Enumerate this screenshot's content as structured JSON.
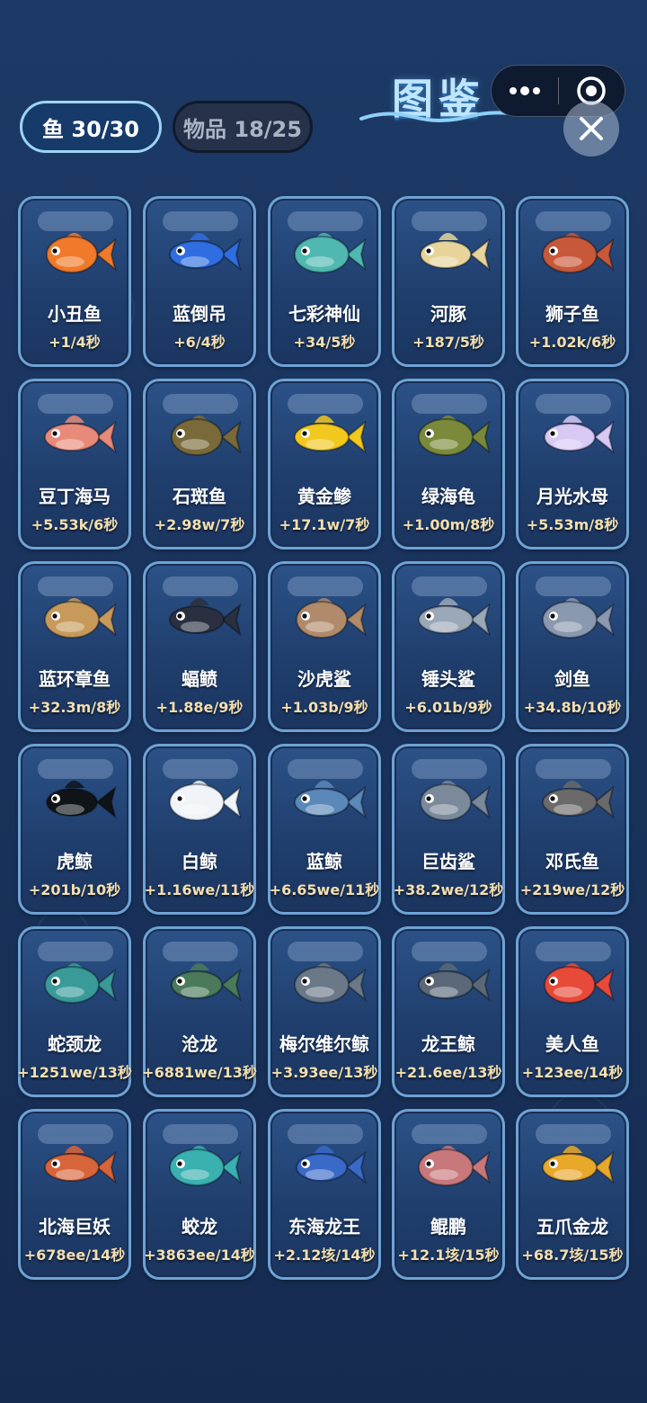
{
  "header": {
    "tabs": [
      {
        "label": "鱼 30/30",
        "active": true
      },
      {
        "label": "物品 18/25",
        "active": false
      }
    ],
    "title": "图鉴",
    "capsule": {
      "menu_icon": "more-dots-icon",
      "target_icon": "target-icon"
    },
    "close_icon": "close-icon"
  },
  "colors": {
    "background": "#1a3560",
    "card_border": "#6ea3d6",
    "rate_text": "#f3dfb0",
    "title": "#bfe6ff"
  },
  "fish": [
    {
      "name": "小丑鱼",
      "rate": "+1/4秒",
      "icon": "clownfish-icon",
      "color": "#f07a2a"
    },
    {
      "name": "蓝倒吊",
      "rate": "+6/4秒",
      "icon": "blue-tang-icon",
      "color": "#2e6ee0"
    },
    {
      "name": "七彩神仙",
      "rate": "+34/5秒",
      "icon": "discus-icon",
      "color": "#4fb8b0"
    },
    {
      "name": "河豚",
      "rate": "+187/5秒",
      "icon": "pufferfish-icon",
      "color": "#e6d49a"
    },
    {
      "name": "狮子鱼",
      "rate": "+1.02k/6秒",
      "icon": "lionfish-icon",
      "color": "#c8583a"
    },
    {
      "name": "豆丁海马",
      "rate": "+5.53k/6秒",
      "icon": "seahorse-icon",
      "color": "#e88a7a"
    },
    {
      "name": "石斑鱼",
      "rate": "+2.98w/7秒",
      "icon": "grouper-icon",
      "color": "#7a6a3a"
    },
    {
      "name": "黄金鲹",
      "rate": "+17.1w/7秒",
      "icon": "golden-trevally-icon",
      "color": "#f2c81e"
    },
    {
      "name": "绿海龟",
      "rate": "+1.00m/8秒",
      "icon": "sea-turtle-icon",
      "color": "#7a8a3a"
    },
    {
      "name": "月光水母",
      "rate": "+5.53m/8秒",
      "icon": "jellyfish-icon",
      "color": "#d8c8f4"
    },
    {
      "name": "蓝环章鱼",
      "rate": "+32.3m/8秒",
      "icon": "blue-ringed-octopus-icon",
      "color": "#c89a5a"
    },
    {
      "name": "蝠鲼",
      "rate": "+1.88e/9秒",
      "icon": "manta-ray-icon",
      "color": "#2a3040"
    },
    {
      "name": "沙虎鲨",
      "rate": "+1.03b/9秒",
      "icon": "sand-tiger-shark-icon",
      "color": "#b08a6a"
    },
    {
      "name": "锤头鲨",
      "rate": "+6.01b/9秒",
      "icon": "hammerhead-shark-icon",
      "color": "#9aa8b8"
    },
    {
      "name": "剑鱼",
      "rate": "+34.8b/10秒",
      "icon": "swordfish-icon",
      "color": "#8a98b0"
    },
    {
      "name": "虎鲸",
      "rate": "+201b/10秒",
      "icon": "orca-icon",
      "color": "#101418"
    },
    {
      "name": "白鲸",
      "rate": "+1.16we/11秒",
      "icon": "beluga-icon",
      "color": "#f0f4f8"
    },
    {
      "name": "蓝鲸",
      "rate": "+6.65we/11秒",
      "icon": "blue-whale-icon",
      "color": "#5a88b8"
    },
    {
      "name": "巨齿鲨",
      "rate": "+38.2we/12秒",
      "icon": "megalodon-icon",
      "color": "#7a8a9a"
    },
    {
      "name": "邓氏鱼",
      "rate": "+219we/12秒",
      "icon": "dunkleosteus-icon",
      "color": "#6a6a6a"
    },
    {
      "name": "蛇颈龙",
      "rate": "+1251we/13秒",
      "icon": "plesiosaur-icon",
      "color": "#3a9a9a"
    },
    {
      "name": "沧龙",
      "rate": "+6881we/13秒",
      "icon": "mosasaur-icon",
      "color": "#4a7a5a"
    },
    {
      "name": "梅尔维尔鲸",
      "rate": "+3.93ee/13秒",
      "icon": "livyatan-icon",
      "color": "#6a7888"
    },
    {
      "name": "龙王鲸",
      "rate": "+21.6ee/13秒",
      "icon": "basilosaurus-icon",
      "color": "#5a6878"
    },
    {
      "name": "美人鱼",
      "rate": "+123ee/14秒",
      "icon": "mermaid-icon",
      "color": "#e84a3a"
    },
    {
      "name": "北海巨妖",
      "rate": "+678ee/14秒",
      "icon": "kraken-icon",
      "color": "#d8643a"
    },
    {
      "name": "蛟龙",
      "rate": "+3863ee/14秒",
      "icon": "jiaolong-icon",
      "color": "#3ab0b0"
    },
    {
      "name": "东海龙王",
      "rate": "+2.12垓/14秒",
      "icon": "dragon-king-icon",
      "color": "#3a6ac8"
    },
    {
      "name": "鲲鹏",
      "rate": "+12.1垓/15秒",
      "icon": "kunpeng-icon",
      "color": "#c8787a"
    },
    {
      "name": "五爪金龙",
      "rate": "+68.7垓/15秒",
      "icon": "golden-dragon-icon",
      "color": "#e8a82a"
    }
  ]
}
